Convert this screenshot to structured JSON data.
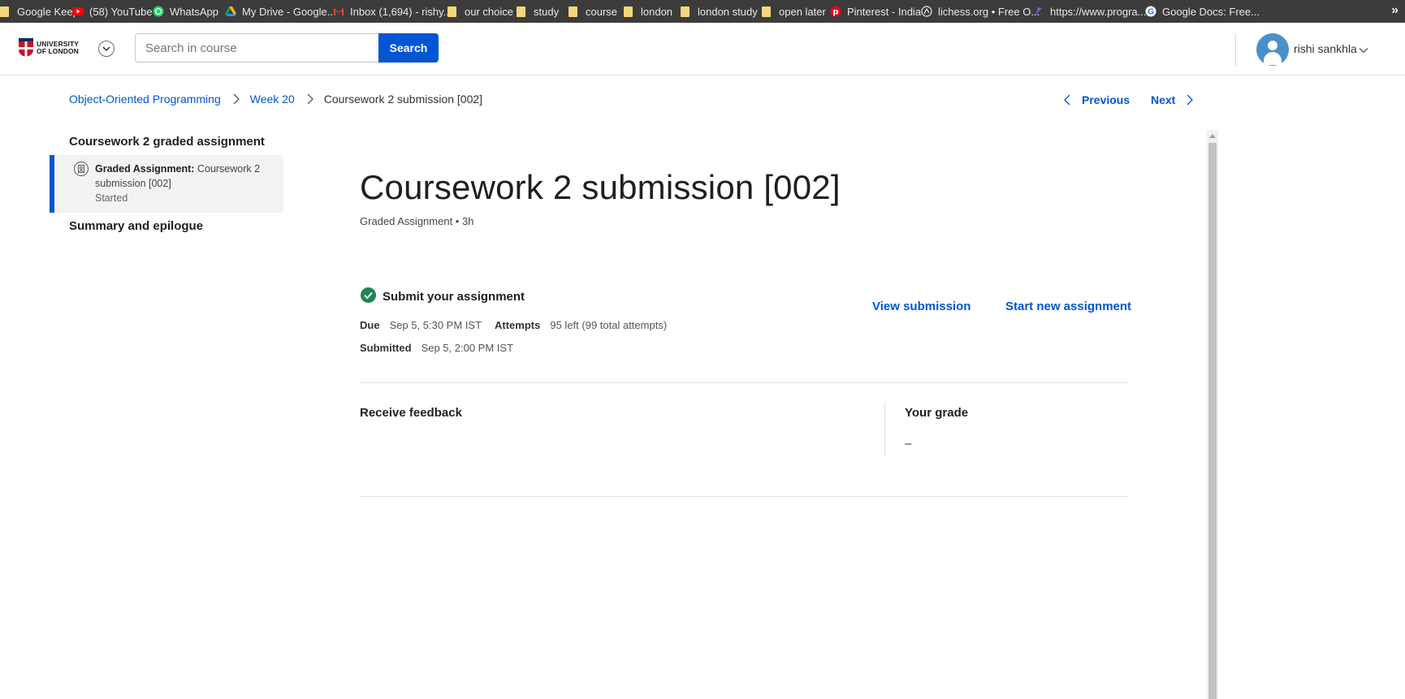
{
  "bookmarks": [
    {
      "label": "Google Keep",
      "icon": "folder-icon"
    },
    {
      "label": "(58) YouTube",
      "icon": "youtube-icon"
    },
    {
      "label": "WhatsApp",
      "icon": "whatsapp-icon"
    },
    {
      "label": "My Drive - Google...",
      "icon": "drive-icon"
    },
    {
      "label": "Inbox (1,694) - rishy...",
      "icon": "gmail-icon"
    },
    {
      "label": "our choice",
      "icon": "folder-icon"
    },
    {
      "label": "study",
      "icon": "folder-icon"
    },
    {
      "label": "course",
      "icon": "folder-icon"
    },
    {
      "label": "london",
      "icon": "folder-icon"
    },
    {
      "label": "london study",
      "icon": "folder-icon"
    },
    {
      "label": "open later",
      "icon": "folder-icon"
    },
    {
      "label": "Pinterest - India",
      "icon": "pinterest-icon"
    },
    {
      "label": "lichess.org • Free O...",
      "icon": "lichess-icon"
    },
    {
      "label": "https://www.progra...",
      "icon": "programiz-icon"
    },
    {
      "label": "Google Docs: Free...",
      "icon": "google-icon"
    }
  ],
  "bookmarks_more": "»",
  "header": {
    "logo_line1": "UNIVERSITY",
    "logo_line2": "OF LONDON",
    "search_placeholder": "Search in course",
    "search_button": "Search",
    "username": "rishi sankhla"
  },
  "breadcrumb": {
    "course": "Object-Oriented Programming",
    "week": "Week 20",
    "current": "Coursework 2 submission [002]"
  },
  "nav": {
    "previous": "Previous",
    "next": "Next"
  },
  "sidebar": {
    "section_title": "Coursework 2 graded assignment",
    "item_prefix": "Graded Assignment:",
    "item_title": "Coursework 2 submission [002]",
    "item_status": "Started",
    "section2_title": "Summary and epilogue"
  },
  "main": {
    "title": "Coursework 2 submission [002]",
    "subtitle": "Graded Assignment • 3h",
    "submit_heading": "Submit your assignment",
    "due_label": "Due",
    "due_value": "Sep 5, 5:30 PM IST",
    "attempts_label": "Attempts",
    "attempts_value": "95 left (99 total attempts)",
    "submitted_label": "Submitted",
    "submitted_value": "Sep 5, 2:00 PM IST",
    "view_submission": "View submission",
    "start_new": "Start new assignment",
    "receive_feedback": "Receive feedback",
    "your_grade": "Your grade",
    "grade_value": "–"
  },
  "colors": {
    "accent": "#0056d2",
    "success": "#1f8354",
    "bookmarks_bg": "#3c3c3c"
  }
}
